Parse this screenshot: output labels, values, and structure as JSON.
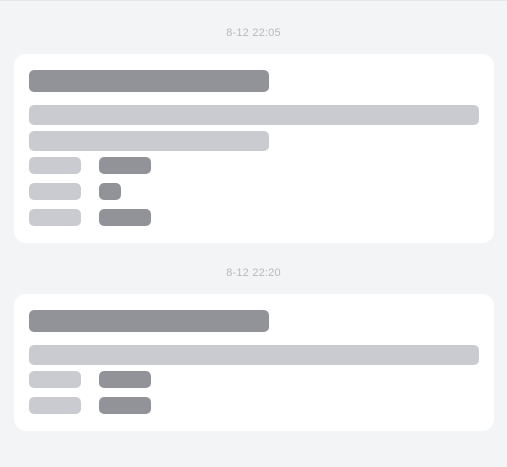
{
  "messages": [
    {
      "timestamp": "8-12 22:05"
    },
    {
      "timestamp": "8-12 22:20"
    }
  ]
}
